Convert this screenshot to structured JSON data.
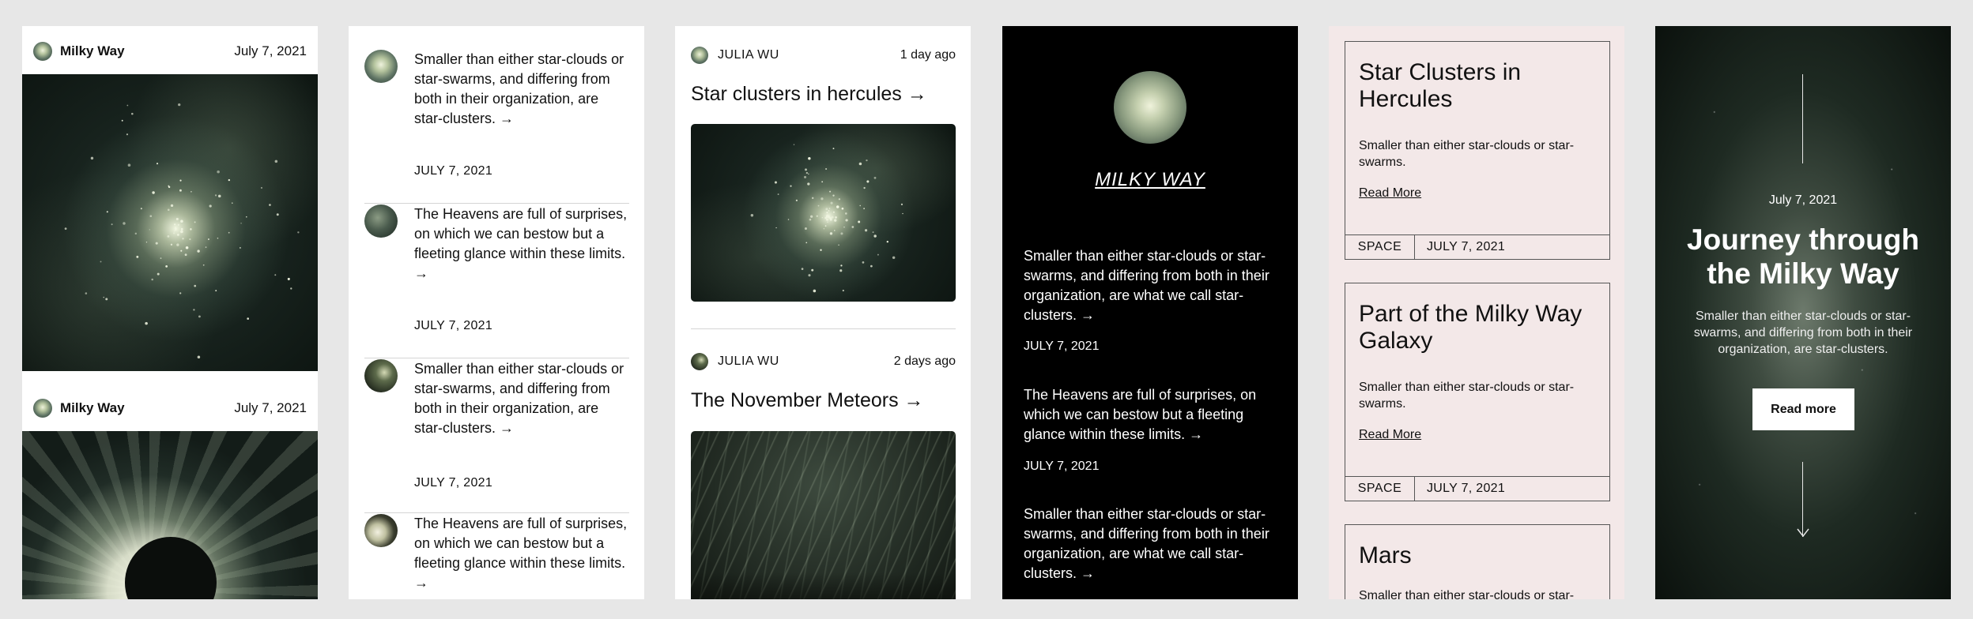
{
  "colors": {
    "canvas": "#e7e7e7",
    "pink_card": "#f3e8e8",
    "dark": "#000000"
  },
  "panel1": {
    "posts": [
      {
        "author": "Milky Way",
        "date": "July 7, 2021",
        "image": "star-cluster"
      },
      {
        "author": "Milky Way",
        "date": "July 7, 2021",
        "image": "solar-eclipse"
      }
    ]
  },
  "panel2": {
    "items": [
      {
        "text": "Smaller than either star-clouds or star-swarms, and differing from both in their organization, are star-clusters. →",
        "date": "JULY 7, 2021",
        "thumb": "cluster"
      },
      {
        "text": "The Heavens are full of surprises, on which we can bestow but a fleeting glance within these limits. →",
        "date": "JULY 7, 2021",
        "thumb": "dark"
      },
      {
        "text": "Smaller than either star-clouds or star-swarms, and differing from both in their organization, are star-clusters. →",
        "date": "JULY 7, 2021",
        "thumb": "meteor"
      },
      {
        "text": "The Heavens are full of surprises, on which we can bestow but a fleeting glance within these limits. →",
        "date": "",
        "thumb": "eclipse"
      }
    ]
  },
  "panel3": {
    "posts": [
      {
        "author": "JULIA WU",
        "ago": "1 day ago",
        "title": "Star clusters in hercules →",
        "image": "star-cluster"
      },
      {
        "author": "JULIA WU",
        "ago": "2 days ago",
        "title": "The November Meteors →",
        "image": "meteors"
      }
    ]
  },
  "panel4": {
    "title": "MILKY WAY",
    "items": [
      {
        "text": "Smaller than either star-clouds or star-swarms, and differing from both in their organization, are what we call star-clusters. →",
        "date": "JULY 7, 2021"
      },
      {
        "text": "The Heavens are full of surprises, on which we can bestow but a fleeting glance within these limits. →",
        "date": "JULY 7, 2021"
      },
      {
        "text": "Smaller than either star-clouds or star-swarms, and differing from both in their organization, are what we call star-clusters. →",
        "date": ""
      }
    ]
  },
  "panel5": {
    "cards": [
      {
        "title": "Star Clusters in Hercules",
        "desc": "Smaller than either star-clouds or star-swarms.",
        "more": "Read More",
        "category": "SPACE",
        "date": "JULY 7, 2021"
      },
      {
        "title": "Part of the Milky Way Galaxy",
        "desc": "Smaller than either star-clouds or star-swarms.",
        "more": "Read More",
        "category": "SPACE",
        "date": "JULY 7, 2021"
      },
      {
        "title": "Mars",
        "desc": "Smaller than either star-clouds or star-swarms."
      }
    ]
  },
  "panel6": {
    "date": "July 7, 2021",
    "title": "Journey through the Milky Way",
    "desc": "Smaller than either star-clouds or star-swarms, and differing from both in their organization, are star-clusters.",
    "button": "Read more",
    "scroll_icon": "arrow-down-icon"
  }
}
